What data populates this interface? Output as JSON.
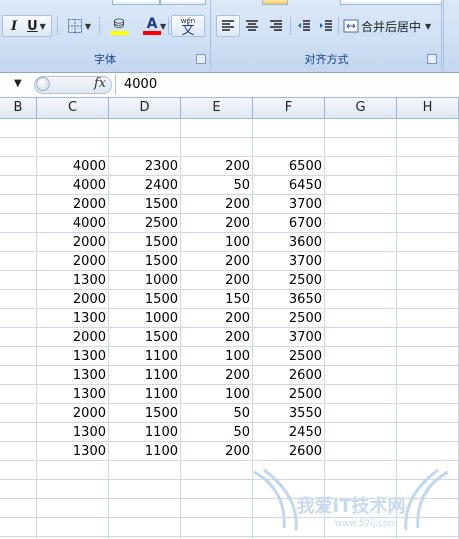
{
  "ribbon": {
    "font_group_label": "字体",
    "align_group_label": "对齐方式",
    "italic_label": "I",
    "underline_label": "U",
    "font_color_label": "A",
    "phonetic_label": "wén",
    "phonetic_char": "文",
    "merge_center_label": "合并后居中",
    "highlight_color": "#ffff00",
    "font_color": "#ff0000"
  },
  "formula_bar": {
    "fx_label": "fx",
    "value": "4000"
  },
  "columns": [
    "B",
    "C",
    "D",
    "E",
    "F",
    "G",
    "H"
  ],
  "rows": [
    [
      "4000",
      "2300",
      "200",
      "6500"
    ],
    [
      "4000",
      "2400",
      "50",
      "6450"
    ],
    [
      "2000",
      "1500",
      "200",
      "3700"
    ],
    [
      "4000",
      "2500",
      "200",
      "6700"
    ],
    [
      "2000",
      "1500",
      "100",
      "3600"
    ],
    [
      "2000",
      "1500",
      "200",
      "3700"
    ],
    [
      "1300",
      "1000",
      "200",
      "2500"
    ],
    [
      "2000",
      "1500",
      "150",
      "3650"
    ],
    [
      "1300",
      "1000",
      "200",
      "2500"
    ],
    [
      "2000",
      "1500",
      "200",
      "3700"
    ],
    [
      "1300",
      "1100",
      "100",
      "2500"
    ],
    [
      "1300",
      "1100",
      "200",
      "2600"
    ],
    [
      "1300",
      "1100",
      "100",
      "2500"
    ],
    [
      "2000",
      "1500",
      "50",
      "3550"
    ],
    [
      "1300",
      "1100",
      "50",
      "2450"
    ],
    [
      "1300",
      "1100",
      "200",
      "2600"
    ]
  ],
  "watermark": {
    "text": "我爱IT技术网",
    "url": "www.52ij.com"
  }
}
